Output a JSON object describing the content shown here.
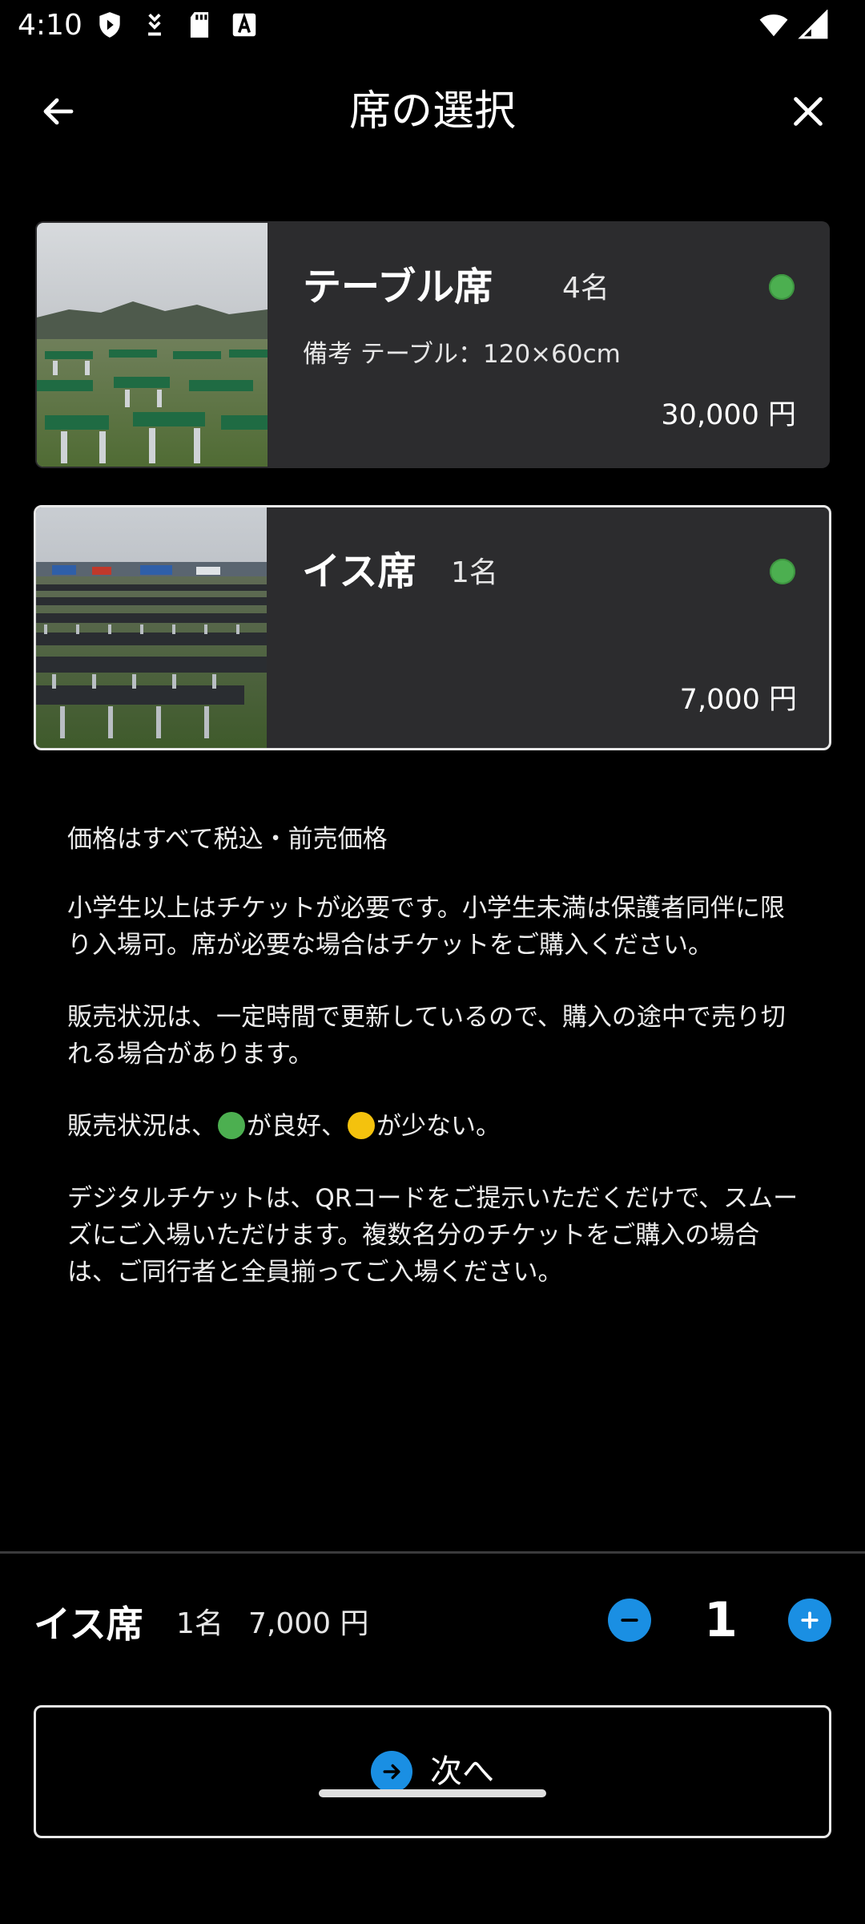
{
  "status_bar": {
    "time": "4:10",
    "left_icons": [
      "shield-icon",
      "download-icon",
      "sd-card-icon",
      "text-a-icon"
    ],
    "right_icons": [
      "wifi-icon",
      "signal-icon"
    ]
  },
  "app_bar": {
    "title": "席の選択",
    "back_icon": "arrow-left-icon",
    "close_icon": "close-icon"
  },
  "seats": [
    {
      "name": "テーブル席",
      "capacity": "4名",
      "note": "備考  テーブル：120×60cm",
      "price": "30,000 円",
      "availability_color": "#4caf50",
      "selected": false
    },
    {
      "name": "イス席",
      "capacity": "1名",
      "note": "",
      "price": "7,000 円",
      "availability_color": "#4caf50",
      "selected": true
    }
  ],
  "notes": {
    "p1": "価格はすべて税込・前売価格",
    "p2": "小学生以上はチケットが必要です。小学生未満は保護者同伴に限り入場可。席が必要な場合はチケットをご購入ください。",
    "p3": "販売状況は、一定時間で更新しているので、購入の途中で売り切れる場合があります。",
    "p4_prefix": "販売状況は、",
    "p4_good": "が良好、",
    "p4_few": "が少ない。",
    "p5": "デジタルチケットは、QRコードをご提示いただくだけで、スムーズにご入場いただけます。複数名分のチケットをご購入の場合は、ご同行者と全員揃ってご入場ください。"
  },
  "selection": {
    "name": "イス席",
    "capacity": "1名",
    "price": "7,000 円",
    "quantity": "1"
  },
  "next_button": {
    "label": "次へ"
  },
  "colors": {
    "accent": "#1a8fe3",
    "available_good": "#4caf50",
    "available_few": "#f4c20d",
    "card_bg": "#2c2c2e"
  }
}
